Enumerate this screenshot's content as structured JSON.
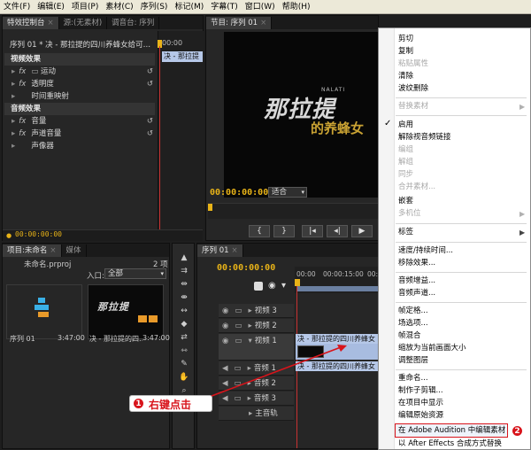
{
  "menubar": [
    "文件(F)",
    "编辑(E)",
    "项目(P)",
    "素材(C)",
    "序列(S)",
    "标记(M)",
    "字幕(T)",
    "窗口(W)",
    "帮助(H)"
  ],
  "effect_panel": {
    "tabs": [
      "特效控制台",
      "源:(无素材)",
      "调音台: 序列"
    ],
    "sequence_label": "序列 01 * 决 - 那拉提的四川养蜂女给可…",
    "ruler_time": "00:00",
    "clip_label": "决 - 那拉提",
    "video_header": "视频效果",
    "audio_header": "音频效果",
    "video_effects": [
      "运动",
      "透明度",
      "时间重映射"
    ],
    "audio_effects": [
      "音量",
      "声道音量",
      "声像器"
    ],
    "fx": "fx",
    "timecode": "00:00:00:00"
  },
  "program_monitor": {
    "tab": "节目: 序列 01",
    "logo_main": "那拉提",
    "logo_small": "NALATI",
    "logo_sub": "的养蜂女",
    "timecode": "00:00:00:00",
    "zoom": "适合"
  },
  "project_panel": {
    "tabs": [
      "项目:未命名",
      "媒体"
    ],
    "filename": "未命名.prproj",
    "item_count": "2 项",
    "entry_label": "入口:",
    "entry_value": "全部",
    "items": [
      {
        "name": "序列 01",
        "duration": "3:47:00"
      },
      {
        "name": "决 - 那拉提的四…",
        "duration": "3:47:00"
      }
    ]
  },
  "timeline": {
    "tab": "序列 01",
    "timecode": "00:00:00:00",
    "ruler_start": "00:00",
    "ruler_mid": "00:00:15:00",
    "ruler_end": "00:00",
    "tracks": [
      "视频 3",
      "视频 2",
      "视频 1",
      "音频 1",
      "音频 2",
      "音频 3",
      "主音轨"
    ],
    "clip_label": "决 - 那拉提的四川养蜂女"
  },
  "context_menu": {
    "items": [
      {
        "label": "剪切",
        "enabled": true
      },
      {
        "label": "复制",
        "enabled": true
      },
      {
        "label": "粘贴属性",
        "enabled": false
      },
      {
        "label": "清除",
        "enabled": true
      },
      {
        "label": "波纹删除",
        "enabled": true
      },
      {
        "label": "替换素材",
        "enabled": false
      },
      {
        "label": "启用",
        "enabled": true,
        "checked": true
      },
      {
        "label": "解除视音频链接",
        "enabled": true
      },
      {
        "label": "编组",
        "enabled": false
      },
      {
        "label": "解组",
        "enabled": false
      },
      {
        "label": "同步",
        "enabled": false
      },
      {
        "label": "合并素材...",
        "enabled": false
      },
      {
        "label": "嵌套",
        "enabled": true
      },
      {
        "label": "多机位",
        "enabled": false
      },
      {
        "label": "标签",
        "enabled": true
      },
      {
        "label": "速度/持续时间...",
        "enabled": true
      },
      {
        "label": "移除效果...",
        "enabled": true
      },
      {
        "label": "音频增益...",
        "enabled": true
      },
      {
        "label": "音频声道...",
        "enabled": true
      },
      {
        "label": "帧定格...",
        "enabled": true
      },
      {
        "label": "场选项...",
        "enabled": true
      },
      {
        "label": "帧混合",
        "enabled": true
      },
      {
        "label": "缩放为当前画面大小",
        "enabled": true
      },
      {
        "label": "调整图层",
        "enabled": true
      },
      {
        "label": "重命名...",
        "enabled": true
      },
      {
        "label": "制作子剪辑...",
        "enabled": true
      },
      {
        "label": "在项目中显示",
        "enabled": true
      },
      {
        "label": "编辑原始资源",
        "enabled": true
      },
      {
        "label": "在 Adobe Audition 中编辑素材",
        "enabled": true,
        "highlighted": true
      },
      {
        "label": "以 After Effects 合成方式替换",
        "enabled": true
      }
    ],
    "checkmark": "✓",
    "submenu_arrow": "▶"
  },
  "annotations": {
    "step1_number": "1",
    "step1_label": "右键点击",
    "step2_number": "2"
  },
  "colors": {
    "timecode": "#e8b318",
    "annotation_red": "#d8141b",
    "clip_blue": "#b6c8e8"
  }
}
